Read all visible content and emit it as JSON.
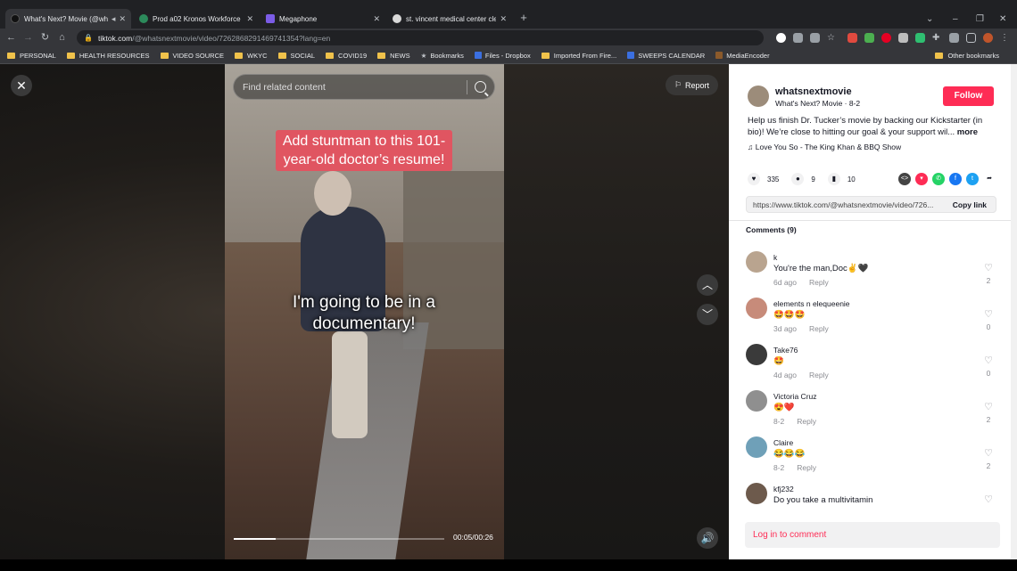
{
  "browser": {
    "tabs": [
      {
        "label": "What's Next? Movie (@whats",
        "active": true,
        "color": "#111111"
      },
      {
        "label": "Prod a02 Kronos Workforce Cent",
        "active": false,
        "color": "#2c8a5b"
      },
      {
        "label": "Megaphone",
        "active": false,
        "color": "#7b5ce6"
      },
      {
        "label": "st. vincent medical center clevela",
        "active": false,
        "color": "#d9d9d9"
      }
    ],
    "url_host": "tiktok.com",
    "url_path": "/@whatsnextmovie/video/7262868291469741354?lang=en",
    "bookmarks": [
      {
        "label": "PERSONAL",
        "icon": "folder-icon"
      },
      {
        "label": "HEALTH RESOURCES",
        "icon": "folder-icon"
      },
      {
        "label": "VIDEO SOURCE",
        "icon": "folder-icon"
      },
      {
        "label": "WKYC",
        "icon": "folder-icon"
      },
      {
        "label": "SOCIAL",
        "icon": "folder-icon"
      },
      {
        "label": "COVID19",
        "icon": "folder-icon"
      },
      {
        "label": "NEWS",
        "icon": "folder-icon"
      },
      {
        "label": "Bookmarks",
        "icon": "star-icon"
      },
      {
        "label": "Files - Dropbox",
        "icon": "dropbox-icon"
      },
      {
        "label": "Imported From Fire...",
        "icon": "folder-icon"
      },
      {
        "label": "SWEEPS CALENDAR",
        "icon": "calendar-icon"
      },
      {
        "label": "MediaEncoder",
        "icon": "media-icon"
      }
    ],
    "other_bookmarks": "Other bookmarks"
  },
  "viewer": {
    "search_placeholder": "Find related content",
    "report_label": "Report",
    "caption_top": "Add stuntman to this 101-year-old doctor’s resume!",
    "caption_mid": "I'm going to be in a documentary!",
    "timecode": "00:05/00:26",
    "progress_fraction": 0.2
  },
  "panel": {
    "username": "whatsnextmovie",
    "subtitle": "What's Next? Movie · 8-2",
    "follow_label": "Follow",
    "description": "Help us finish Dr. Tucker’s movie by backing our Kickstarter (in bio)! We’re close to hitting our goal & your support wil...",
    "more_label": "more",
    "music": "Love You So - The King Khan & BBQ Show",
    "likes": "335",
    "comments_count": "9",
    "saves": "10",
    "link_url": "https://www.tiktok.com/@whatsnextmovie/video/726...",
    "copy_label": "Copy link",
    "comments_header": "Comments (9)",
    "comments": [
      {
        "name": "k",
        "text": "You're the man,Doc✌️🖤",
        "date": "6d ago",
        "likes": "2",
        "avatar_color": "#b9a48f"
      },
      {
        "name": "elements n elequeenie",
        "text": "🤩🤩🤩",
        "date": "3d ago",
        "likes": "0",
        "avatar_color": "#c78b7a"
      },
      {
        "name": "Take76",
        "text": "🤩",
        "date": "4d ago",
        "likes": "0",
        "avatar_color": "#3a3a3a"
      },
      {
        "name": "Victoria Cruz",
        "text": "😍❤️",
        "date": "8-2",
        "likes": "2",
        "avatar_color": "#8f8f8f"
      },
      {
        "name": "Claire",
        "text": "😂😂😂",
        "date": "8-2",
        "likes": "2",
        "avatar_color": "#6fa0b8"
      },
      {
        "name": "kfj232",
        "text": "Do you take a multivitamin",
        "date": "",
        "likes": "",
        "avatar_color": "#6d5a4c"
      }
    ],
    "reply_label": "Reply",
    "login_comment": "Log in to comment"
  },
  "colors": {
    "accent": "#fe2c55",
    "chrome_bg": "#202124",
    "toolbar_bg": "#35363a"
  }
}
